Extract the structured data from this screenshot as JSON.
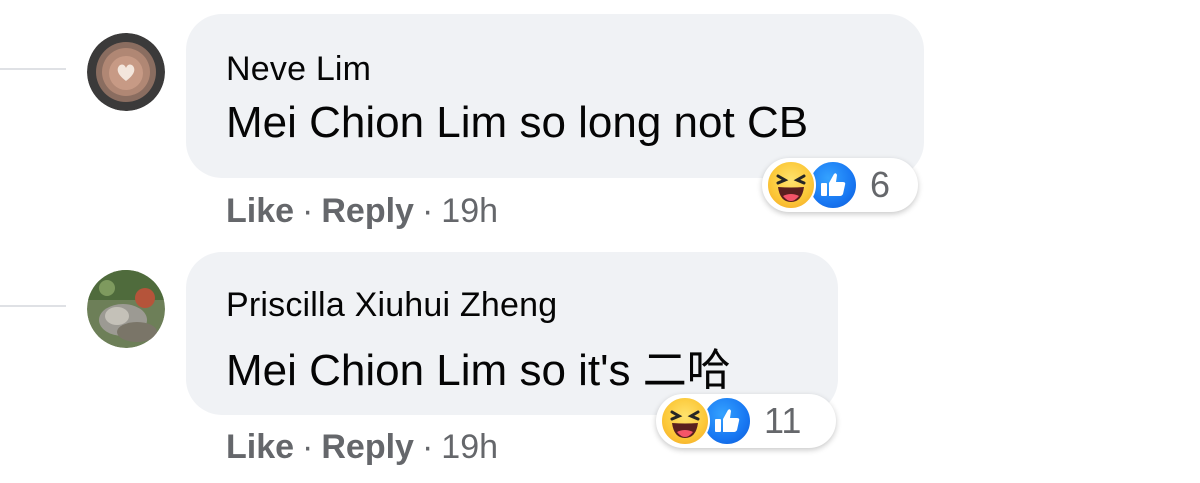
{
  "colors": {
    "bubble_bg": "#f0f2f5",
    "text_primary": "#050505",
    "text_secondary": "#65676b",
    "like_blue": "#1877f2",
    "haha_yellow": "#fcc93a"
  },
  "comments": [
    {
      "author": "Neve Lim",
      "mention": "Mei Chion Lim",
      "text": "so long not CB",
      "reactions": {
        "icons": [
          "haha-icon",
          "like-icon"
        ],
        "count": "6"
      },
      "actions": {
        "like": "Like",
        "reply": "Reply",
        "separator": "·",
        "time": "19h"
      }
    },
    {
      "author": "Priscilla Xiuhui Zheng",
      "mention": "Mei Chion Lim",
      "text": "so it's 二哈",
      "reactions": {
        "icons": [
          "haha-icon",
          "like-icon"
        ],
        "count": "11"
      },
      "actions": {
        "like": "Like",
        "reply": "Reply",
        "separator": "·",
        "time": "19h"
      }
    }
  ]
}
